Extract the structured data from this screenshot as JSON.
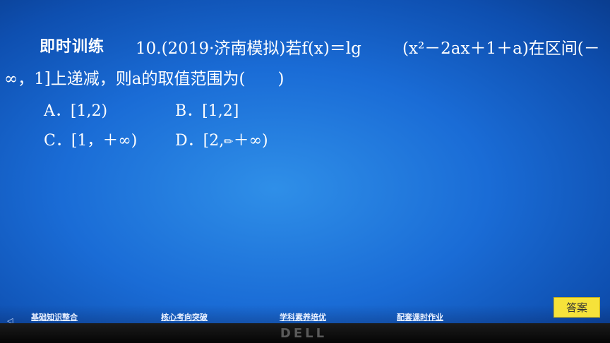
{
  "slide": {
    "title": "即时训练",
    "question_part1": "10.(2019·济南模拟)若f(x)＝lg",
    "question_part2": "(x²－2ax＋1＋a)在区间(－",
    "question_part3": "∞，1]上递减，则a的取值范围为(　　)",
    "options": {
      "a": "A．[1,2)",
      "b": "B．[1,2]",
      "c": "C．[1，＋∞)",
      "d_prefix": "D．[2,",
      "d_suffix": "＋∞)"
    }
  },
  "nav": {
    "link1": "基础知识整合",
    "link2": "核心考向突破",
    "link3": "学科素养培优",
    "link4": "配套课时作业"
  },
  "answer_button": "答案",
  "monitor_brand": "DELL",
  "icons": {
    "pen": "pen-cursor-icon",
    "corner": "back-arrow-icon"
  },
  "colors": {
    "background": "#1a6cd6",
    "answer_button": "#f6e23a"
  }
}
